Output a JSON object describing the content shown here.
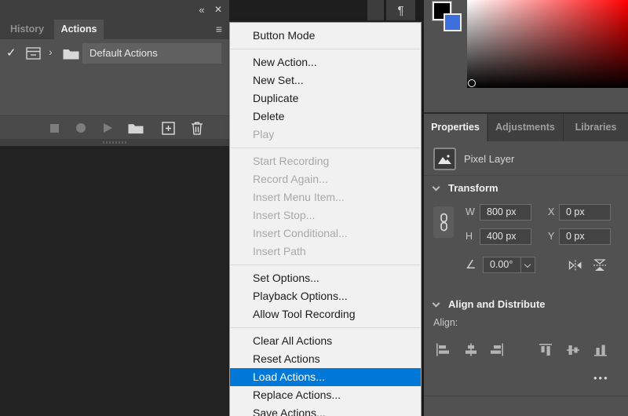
{
  "actions_panel": {
    "titlebar": {
      "collapse_glyph": "«",
      "close_glyph": "✕"
    },
    "tabs": [
      {
        "label": "History"
      },
      {
        "label": "Actions"
      }
    ],
    "flyout_glyph": "≡",
    "row": {
      "check_glyph": "✓",
      "expand_glyph": "›",
      "label": "Default Actions"
    }
  },
  "dock": {
    "paragraph_glyph": "¶"
  },
  "menu": {
    "highlight_color": "#0078d7",
    "items": [
      {
        "label": "Button Mode",
        "state": "normal"
      },
      {
        "label": "New Action...",
        "state": "normal"
      },
      {
        "label": "New Set...",
        "state": "normal"
      },
      {
        "label": "Duplicate",
        "state": "normal"
      },
      {
        "label": "Delete",
        "state": "normal"
      },
      {
        "label": "Play",
        "state": "disabled"
      },
      {
        "label": "Start Recording",
        "state": "disabled"
      },
      {
        "label": "Record Again...",
        "state": "disabled"
      },
      {
        "label": "Insert Menu Item...",
        "state": "disabled"
      },
      {
        "label": "Insert Stop...",
        "state": "disabled"
      },
      {
        "label": "Insert Conditional...",
        "state": "disabled"
      },
      {
        "label": "Insert Path",
        "state": "disabled"
      },
      {
        "label": "Set Options...",
        "state": "normal"
      },
      {
        "label": "Playback Options...",
        "state": "normal"
      },
      {
        "label": "Allow Tool Recording",
        "state": "normal"
      },
      {
        "label": "Clear All Actions",
        "state": "normal"
      },
      {
        "label": "Reset Actions",
        "state": "normal"
      },
      {
        "label": "Load Actions...",
        "state": "highlighted"
      },
      {
        "label": "Replace Actions...",
        "state": "normal"
      },
      {
        "label": "Save Actions...",
        "state": "normal"
      }
    ]
  },
  "right_panel": {
    "swatches": {
      "foreground_color": "#000000",
      "background_color": "#3d6fdd"
    },
    "color_field": {
      "hue_color": "#ff0000"
    },
    "tabs": [
      {
        "label": "Properties"
      },
      {
        "label": "Adjustments"
      },
      {
        "label": "Libraries"
      }
    ],
    "layer_type": "Pixel Layer",
    "transform": {
      "title": "Transform",
      "w_label": "W",
      "w_value": "800 px",
      "h_label": "H",
      "h_value": "400 px",
      "x_label": "X",
      "x_value": "0 px",
      "y_label": "Y",
      "y_value": "0 px",
      "angle_glyph": "∠",
      "angle_value": "0.00°"
    },
    "align": {
      "title": "Align and Distribute",
      "align_label": "Align:",
      "more_glyph": "•••"
    }
  }
}
